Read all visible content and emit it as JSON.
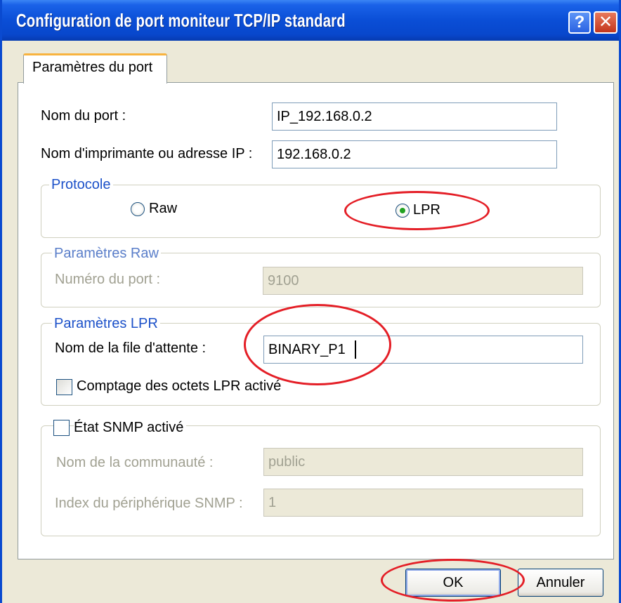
{
  "window": {
    "title": "Configuration de port moniteur TCP/IP standard",
    "help_glyph": "?",
    "close_glyph": "✕"
  },
  "tab": {
    "label": "Paramètres du port"
  },
  "port": {
    "name_label": "Nom du port :",
    "name_value": "IP_192.168.0.2",
    "address_label": "Nom d'imprimante ou adresse IP :",
    "address_value": "192.168.0.2"
  },
  "protocol": {
    "title": "Protocole",
    "raw_label": "Raw",
    "lpr_label": "LPR",
    "selected": "LPR"
  },
  "raw_settings": {
    "title": "Paramètres Raw",
    "port_number_label": "Numéro du port :",
    "port_number_value": "9100"
  },
  "lpr_settings": {
    "title": "Paramètres LPR",
    "queue_label": "Nom de la file d'attente :",
    "queue_value": "BINARY_P1",
    "byte_count_label": "Comptage des octets LPR activé",
    "byte_count_checked": false
  },
  "snmp": {
    "label": "État SNMP activé",
    "checked": false,
    "community_label": "Nom de la communauté :",
    "community_value": "public",
    "device_index_label": "Index du périphérique SNMP :",
    "device_index_value": "1"
  },
  "buttons": {
    "ok": "OK",
    "cancel": "Annuler"
  },
  "colors": {
    "annotation": "#e41e26",
    "titlebar": "#0a4ed6",
    "group_title": "#1c51c9"
  }
}
